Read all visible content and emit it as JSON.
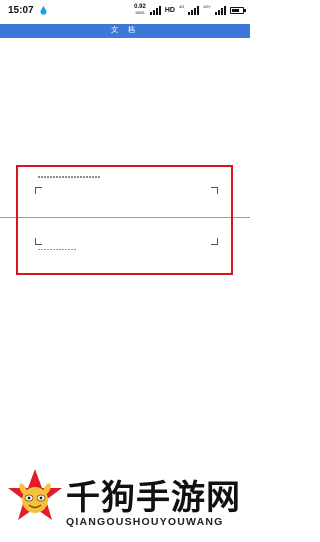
{
  "status_bar": {
    "time": "15:07",
    "net_speed_value": "0.92",
    "net_speed_unit": "KB/S",
    "network_label": "HD",
    "sim_label_1": "4G",
    "sim_label_2": "4G+",
    "battery_level": 0.7
  },
  "title_bar": {
    "title": "文 档"
  },
  "watermark": {
    "brand_name": "千狗手游网",
    "brand_url": "QIANGOUSHOUYOUWANG"
  },
  "colors": {
    "title_bar": "#3d78d8",
    "scan_frame": "#d6161c"
  }
}
